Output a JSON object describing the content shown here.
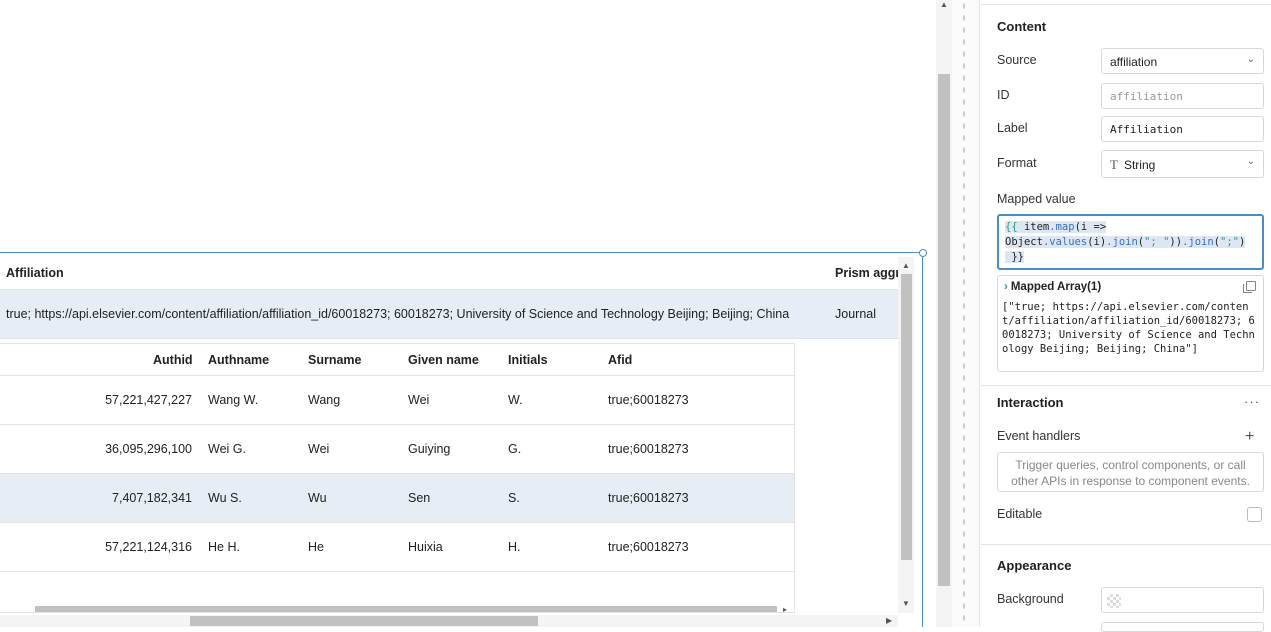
{
  "table": {
    "columns": [
      "Affiliation",
      "Prism aggr"
    ],
    "row": {
      "affiliation": "true; https://api.elsevier.com/content/affiliation/affiliation_id/60018273; 60018273; University of Science and Technology Beijing; Beijing; China",
      "prism": "Journal"
    }
  },
  "nested_table": {
    "columns": [
      "Authid",
      "Authname",
      "Surname",
      "Given name",
      "Initials",
      "Afid"
    ],
    "rows": [
      {
        "authid": "57,221,427,227",
        "authname": "Wang W.",
        "surname": "Wang",
        "given": "Wei",
        "initials": "W.",
        "afid": "true;60018273"
      },
      {
        "authid": "36,095,296,100",
        "authname": "Wei G.",
        "surname": "Wei",
        "given": "Guiying",
        "initials": "G.",
        "afid": "true;60018273"
      },
      {
        "authid": "7,407,182,341",
        "authname": "Wu S.",
        "surname": "Wu",
        "given": "Sen",
        "initials": "S.",
        "afid": "true;60018273"
      },
      {
        "authid": "57,221,124,316",
        "authname": "He H.",
        "surname": "He",
        "given": "Huixia",
        "initials": "H.",
        "afid": "true;60018273"
      }
    ],
    "selected_row": 2
  },
  "panel": {
    "content_title": "Content",
    "source_label": "Source",
    "source_value": "affiliation",
    "id_label": "ID",
    "id_placeholder": "affiliation",
    "label_label": "Label",
    "label_value": "Affiliation",
    "format_label": "Format",
    "format_value": "String",
    "format_icon": "T",
    "mapped_label": "Mapped value",
    "mapped_code_line1a": "{{ ",
    "mapped_code_line1b": "item",
    "mapped_code_line1c": ".map",
    "mapped_code_line1d": "(i =>",
    "mapped_code_line2a": "Object",
    "mapped_code_line2b": ".values",
    "mapped_code_line2c": "(i)",
    "mapped_code_line2d": ".join",
    "mapped_code_line2e": "(",
    "mapped_code_line2f": "\"; \"",
    "mapped_code_line2g": "))",
    "mapped_code_line2h": ".join",
    "mapped_code_line2i": "(",
    "mapped_code_line2j": "\";\"",
    "mapped_code_line2k": ")",
    "mapped_code_line3": " }}",
    "result_title": "Mapped Array(1)",
    "result_body": "[\"true; https://api.elsevier.com/content/affiliation/affiliation_id/60018273; 60018273; University of Science and Technology Beijing; Beijing; China\"]",
    "interaction_title": "Interaction",
    "event_handlers_label": "Event handlers",
    "event_hint": "Trigger queries, control components, or call other APIs in response to component events.",
    "editable_label": "Editable",
    "appearance_title": "Appearance",
    "background_label": "Background"
  }
}
